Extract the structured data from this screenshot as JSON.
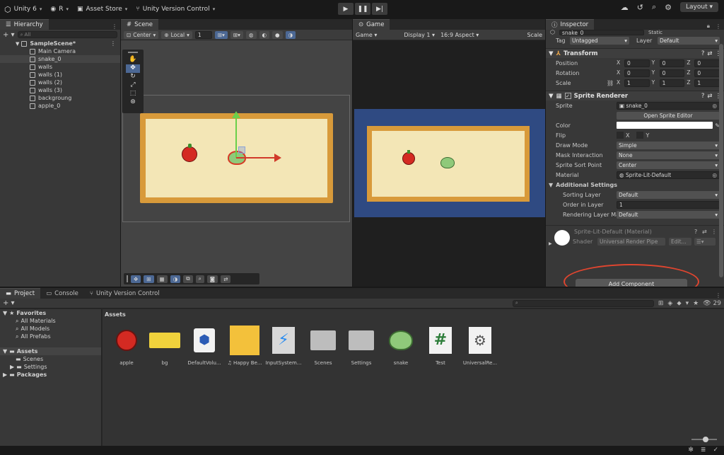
{
  "topbar": {
    "account": "Unity 6",
    "user": "R",
    "asset_store": "Asset Store",
    "version_control": "Unity Version Control",
    "layout": "Layout"
  },
  "hierarchy": {
    "tab": "Hierarchy",
    "search_placeholder": "All",
    "scene_name": "SampleScene*",
    "items": [
      "Main Camera",
      "snake_0",
      "walls",
      "walls (1)",
      "walls (2)",
      "walls (3)",
      "backgroung",
      "apple_0"
    ]
  },
  "scene": {
    "tab": "Scene",
    "pivot": "Center",
    "space": "Local",
    "grid_value": "1"
  },
  "game": {
    "tab": "Game",
    "mode": "Game",
    "display": "Display 1",
    "aspect": "16:9 Aspect",
    "scale_label": "Scale"
  },
  "inspector": {
    "tab": "Inspector",
    "object_name": "snake_0",
    "static_label": "Static",
    "tag_label": "Tag",
    "tag_value": "Untagged",
    "layer_label": "Layer",
    "layer_value": "Default",
    "transform": {
      "title": "Transform",
      "position_label": "Position",
      "rotation_label": "Rotation",
      "scale_label": "Scale",
      "position": [
        "0",
        "0",
        "0"
      ],
      "rotation": [
        "0",
        "0",
        "0"
      ],
      "scale": [
        "1",
        "1",
        "1"
      ]
    },
    "sprite_renderer": {
      "title": "Sprite Renderer",
      "sprite_label": "Sprite",
      "sprite_value": "snake_0",
      "open_editor": "Open Sprite Editor",
      "color_label": "Color",
      "flip_label": "Flip",
      "flip_x": "X",
      "flip_y": "Y",
      "draw_mode_label": "Draw Mode",
      "draw_mode_value": "Simple",
      "mask_label": "Mask Interaction",
      "mask_value": "None",
      "sort_point_label": "Sprite Sort Point",
      "sort_point_value": "Center",
      "material_label": "Material",
      "material_value": "Sprite-Lit-Default",
      "additional_label": "Additional Settings",
      "sorting_layer_label": "Sorting Layer",
      "sorting_layer_value": "Default",
      "order_label": "Order in Layer",
      "order_value": "1",
      "rendering_mask_label": "Rendering Layer Ma",
      "rendering_mask_value": "Default"
    },
    "material": {
      "title": "Sprite-Lit-Default (Material)",
      "shader_label": "Shader",
      "shader_value": "Universal Render Pipe",
      "edit_label": "Edit..."
    },
    "add_component": "Add Component"
  },
  "project": {
    "tab_project": "Project",
    "tab_console": "Console",
    "tab_vc": "Unity Version Control",
    "count": "29",
    "favorites": "Favorites",
    "fav_items": [
      "All Materials",
      "All Models",
      "All Prefabs"
    ],
    "assets_label": "Assets",
    "asset_folders": [
      "Scenes",
      "Settings"
    ],
    "packages": "Packages",
    "breadcrumb": "Assets",
    "assets": [
      "apple",
      "bg",
      "DefaultVolu...",
      "Happy Be...",
      "InputSystem...",
      "Scenes",
      "Settings",
      "snake",
      "Test",
      "UniversalRe..."
    ]
  },
  "colors": {
    "highlight_ring": "#e0452f",
    "game_bg": "#2f4a82",
    "board_border": "#d89a3a",
    "board_fill": "#f3e6b6"
  }
}
